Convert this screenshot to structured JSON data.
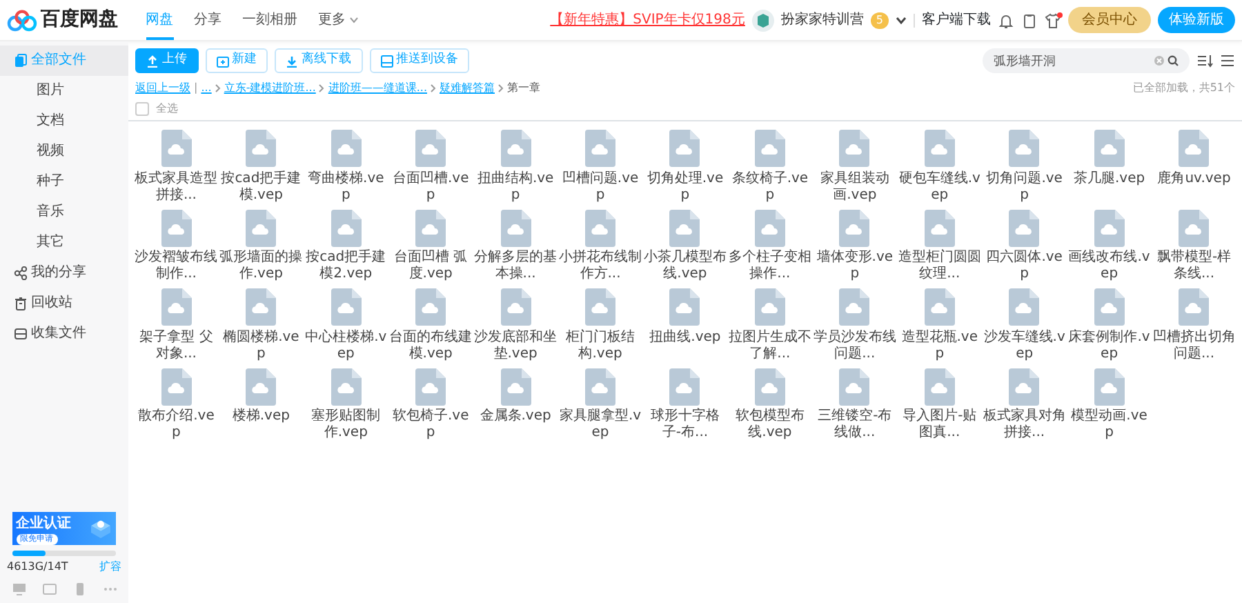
{
  "header": {
    "logo_text": "百度网盘",
    "nav_tabs": [
      {
        "label": "网盘",
        "selected": true,
        "dropdown": false
      },
      {
        "label": "分享",
        "selected": false,
        "dropdown": false
      },
      {
        "label": "一刻相册",
        "selected": false,
        "dropdown": false
      },
      {
        "label": "更多",
        "selected": false,
        "dropdown": true
      }
    ],
    "promo_link": "【新年特惠】SVIP年卡仅198元",
    "user": {
      "name": "扮家家特训营",
      "level_badge": "5"
    },
    "client_download": "客户端下载",
    "icons": [
      {
        "kind": "bell",
        "unread": false
      },
      {
        "kind": "clipboard",
        "unread": false
      },
      {
        "kind": "shirt",
        "unread": true
      }
    ],
    "member_button": "会员中心",
    "new_version_button": "体验新版"
  },
  "sidebar": {
    "items": [
      {
        "label": "全部文件",
        "kind": "files",
        "selected": true
      },
      {
        "label": "图片",
        "kind": "sub",
        "selected": false
      },
      {
        "label": "文档",
        "kind": "sub",
        "selected": false
      },
      {
        "label": "视频",
        "kind": "sub",
        "selected": false
      },
      {
        "label": "种子",
        "kind": "sub",
        "selected": false
      },
      {
        "label": "音乐",
        "kind": "sub",
        "selected": false
      },
      {
        "label": "其它",
        "kind": "sub",
        "selected": false
      },
      {
        "label": "我的分享",
        "kind": "share",
        "selected": false
      },
      {
        "label": "回收站",
        "kind": "trash",
        "selected": false
      },
      {
        "label": "收集文件",
        "kind": "collect",
        "selected": false
      }
    ],
    "banner": {
      "title": "企业认证",
      "button": "限免申请"
    },
    "storage": {
      "level": 0.32,
      "text": "4613G/14T",
      "expand_link": "扩容"
    }
  },
  "toolbar": {
    "buttons": [
      {
        "label": "上传",
        "kind": "upload"
      },
      {
        "label": "新建",
        "kind": "new"
      },
      {
        "label": "离线下载",
        "kind": "download"
      },
      {
        "label": "推送到设备",
        "kind": "device"
      }
    ],
    "search": {
      "value": "弧形墙开洞"
    }
  },
  "breadcrumb": {
    "back": "返回上一级",
    "separator": "|",
    "ellipsis": "...",
    "items": [
      "立东-建模进阶班...",
      "进阶班——缝道课...",
      "疑难解答篇",
      "第一章"
    ]
  },
  "load_status": "已全部加载，共51个",
  "select_all": {
    "label": "全选",
    "checked": false
  },
  "files": [
    "板式家具造型拼接...",
    "按cad把手建模.vep",
    "弯曲楼梯.vep",
    "台面凹槽.vep",
    "扭曲结构.vep",
    "凹槽问题.vep",
    "切角处理.vep",
    "条纹椅子.vep",
    "家具组装动画.vep",
    "硬包车缝线.vep",
    "切角问题.vep",
    "茶几腿.vep",
    "鹿角uv.vep",
    "沙发褶皱布线制作...",
    "弧形墙面的操作.vep",
    "按cad把手建模2.vep",
    "台面凹槽 弧度.vep",
    "分解多层的基本操...",
    "小拼花布线制作方...",
    "小茶几模型布线.vep",
    "多个柱子变相操作...",
    "墙体变形.vep",
    "造型柜门圆圆纹理...",
    "四六圆体.vep",
    "画线改布线.vep",
    "飘带模型-样条线...",
    "架子拿型 父对象...",
    "椭圆楼梯.vep",
    "中心柱楼梯.vep",
    "台面的布线建模.vep",
    "沙发底部和坐垫.vep",
    "柜门门板结构.vep",
    "扭曲线.vep",
    "拉图片生成不了解...",
    "学员沙发布线问题...",
    "造型花瓶.vep",
    "沙发车缝线.vep",
    "床套例制作.vep",
    "凹槽挤出切角问题...",
    "散布介绍.vep",
    "楼梯.vep",
    "塞形贴图制作.vep",
    "软包椅子.vep",
    "金属条.vep",
    "家具腿拿型.vep",
    "球形十字格子-布...",
    "软包模型布线.vep",
    "三维镂空-布线做...",
    "导入图片-贴图真...",
    "板式家具对角拼接...",
    "模型动画.vep"
  ]
}
